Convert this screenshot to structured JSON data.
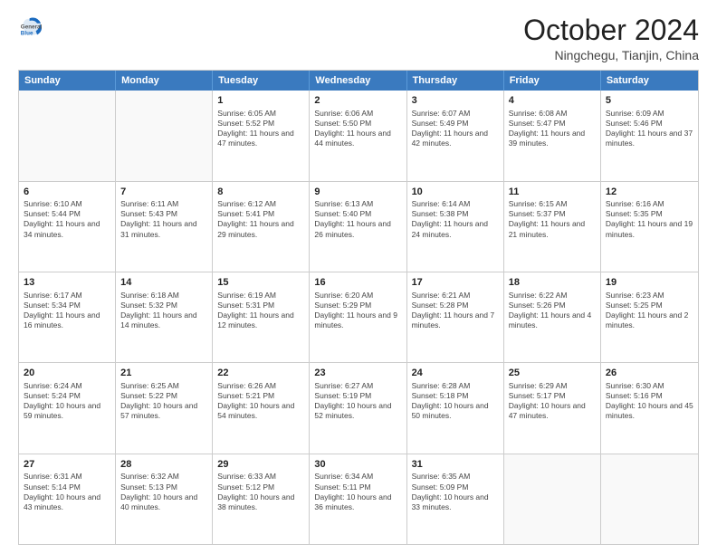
{
  "header": {
    "logo": {
      "general": "General",
      "blue": "Blue"
    },
    "title": "October 2024",
    "location": "Ningchegu, Tianjin, China"
  },
  "days_of_week": [
    "Sunday",
    "Monday",
    "Tuesday",
    "Wednesday",
    "Thursday",
    "Friday",
    "Saturday"
  ],
  "weeks": [
    [
      {
        "day": "",
        "empty": true
      },
      {
        "day": "",
        "empty": true
      },
      {
        "day": "1",
        "sunrise": "Sunrise: 6:05 AM",
        "sunset": "Sunset: 5:52 PM",
        "daylight": "Daylight: 11 hours and 47 minutes."
      },
      {
        "day": "2",
        "sunrise": "Sunrise: 6:06 AM",
        "sunset": "Sunset: 5:50 PM",
        "daylight": "Daylight: 11 hours and 44 minutes."
      },
      {
        "day": "3",
        "sunrise": "Sunrise: 6:07 AM",
        "sunset": "Sunset: 5:49 PM",
        "daylight": "Daylight: 11 hours and 42 minutes."
      },
      {
        "day": "4",
        "sunrise": "Sunrise: 6:08 AM",
        "sunset": "Sunset: 5:47 PM",
        "daylight": "Daylight: 11 hours and 39 minutes."
      },
      {
        "day": "5",
        "sunrise": "Sunrise: 6:09 AM",
        "sunset": "Sunset: 5:46 PM",
        "daylight": "Daylight: 11 hours and 37 minutes."
      }
    ],
    [
      {
        "day": "6",
        "sunrise": "Sunrise: 6:10 AM",
        "sunset": "Sunset: 5:44 PM",
        "daylight": "Daylight: 11 hours and 34 minutes."
      },
      {
        "day": "7",
        "sunrise": "Sunrise: 6:11 AM",
        "sunset": "Sunset: 5:43 PM",
        "daylight": "Daylight: 11 hours and 31 minutes."
      },
      {
        "day": "8",
        "sunrise": "Sunrise: 6:12 AM",
        "sunset": "Sunset: 5:41 PM",
        "daylight": "Daylight: 11 hours and 29 minutes."
      },
      {
        "day": "9",
        "sunrise": "Sunrise: 6:13 AM",
        "sunset": "Sunset: 5:40 PM",
        "daylight": "Daylight: 11 hours and 26 minutes."
      },
      {
        "day": "10",
        "sunrise": "Sunrise: 6:14 AM",
        "sunset": "Sunset: 5:38 PM",
        "daylight": "Daylight: 11 hours and 24 minutes."
      },
      {
        "day": "11",
        "sunrise": "Sunrise: 6:15 AM",
        "sunset": "Sunset: 5:37 PM",
        "daylight": "Daylight: 11 hours and 21 minutes."
      },
      {
        "day": "12",
        "sunrise": "Sunrise: 6:16 AM",
        "sunset": "Sunset: 5:35 PM",
        "daylight": "Daylight: 11 hours and 19 minutes."
      }
    ],
    [
      {
        "day": "13",
        "sunrise": "Sunrise: 6:17 AM",
        "sunset": "Sunset: 5:34 PM",
        "daylight": "Daylight: 11 hours and 16 minutes."
      },
      {
        "day": "14",
        "sunrise": "Sunrise: 6:18 AM",
        "sunset": "Sunset: 5:32 PM",
        "daylight": "Daylight: 11 hours and 14 minutes."
      },
      {
        "day": "15",
        "sunrise": "Sunrise: 6:19 AM",
        "sunset": "Sunset: 5:31 PM",
        "daylight": "Daylight: 11 hours and 12 minutes."
      },
      {
        "day": "16",
        "sunrise": "Sunrise: 6:20 AM",
        "sunset": "Sunset: 5:29 PM",
        "daylight": "Daylight: 11 hours and 9 minutes."
      },
      {
        "day": "17",
        "sunrise": "Sunrise: 6:21 AM",
        "sunset": "Sunset: 5:28 PM",
        "daylight": "Daylight: 11 hours and 7 minutes."
      },
      {
        "day": "18",
        "sunrise": "Sunrise: 6:22 AM",
        "sunset": "Sunset: 5:26 PM",
        "daylight": "Daylight: 11 hours and 4 minutes."
      },
      {
        "day": "19",
        "sunrise": "Sunrise: 6:23 AM",
        "sunset": "Sunset: 5:25 PM",
        "daylight": "Daylight: 11 hours and 2 minutes."
      }
    ],
    [
      {
        "day": "20",
        "sunrise": "Sunrise: 6:24 AM",
        "sunset": "Sunset: 5:24 PM",
        "daylight": "Daylight: 10 hours and 59 minutes."
      },
      {
        "day": "21",
        "sunrise": "Sunrise: 6:25 AM",
        "sunset": "Sunset: 5:22 PM",
        "daylight": "Daylight: 10 hours and 57 minutes."
      },
      {
        "day": "22",
        "sunrise": "Sunrise: 6:26 AM",
        "sunset": "Sunset: 5:21 PM",
        "daylight": "Daylight: 10 hours and 54 minutes."
      },
      {
        "day": "23",
        "sunrise": "Sunrise: 6:27 AM",
        "sunset": "Sunset: 5:19 PM",
        "daylight": "Daylight: 10 hours and 52 minutes."
      },
      {
        "day": "24",
        "sunrise": "Sunrise: 6:28 AM",
        "sunset": "Sunset: 5:18 PM",
        "daylight": "Daylight: 10 hours and 50 minutes."
      },
      {
        "day": "25",
        "sunrise": "Sunrise: 6:29 AM",
        "sunset": "Sunset: 5:17 PM",
        "daylight": "Daylight: 10 hours and 47 minutes."
      },
      {
        "day": "26",
        "sunrise": "Sunrise: 6:30 AM",
        "sunset": "Sunset: 5:16 PM",
        "daylight": "Daylight: 10 hours and 45 minutes."
      }
    ],
    [
      {
        "day": "27",
        "sunrise": "Sunrise: 6:31 AM",
        "sunset": "Sunset: 5:14 PM",
        "daylight": "Daylight: 10 hours and 43 minutes."
      },
      {
        "day": "28",
        "sunrise": "Sunrise: 6:32 AM",
        "sunset": "Sunset: 5:13 PM",
        "daylight": "Daylight: 10 hours and 40 minutes."
      },
      {
        "day": "29",
        "sunrise": "Sunrise: 6:33 AM",
        "sunset": "Sunset: 5:12 PM",
        "daylight": "Daylight: 10 hours and 38 minutes."
      },
      {
        "day": "30",
        "sunrise": "Sunrise: 6:34 AM",
        "sunset": "Sunset: 5:11 PM",
        "daylight": "Daylight: 10 hours and 36 minutes."
      },
      {
        "day": "31",
        "sunrise": "Sunrise: 6:35 AM",
        "sunset": "Sunset: 5:09 PM",
        "daylight": "Daylight: 10 hours and 33 minutes."
      },
      {
        "day": "",
        "empty": true
      },
      {
        "day": "",
        "empty": true
      }
    ]
  ]
}
